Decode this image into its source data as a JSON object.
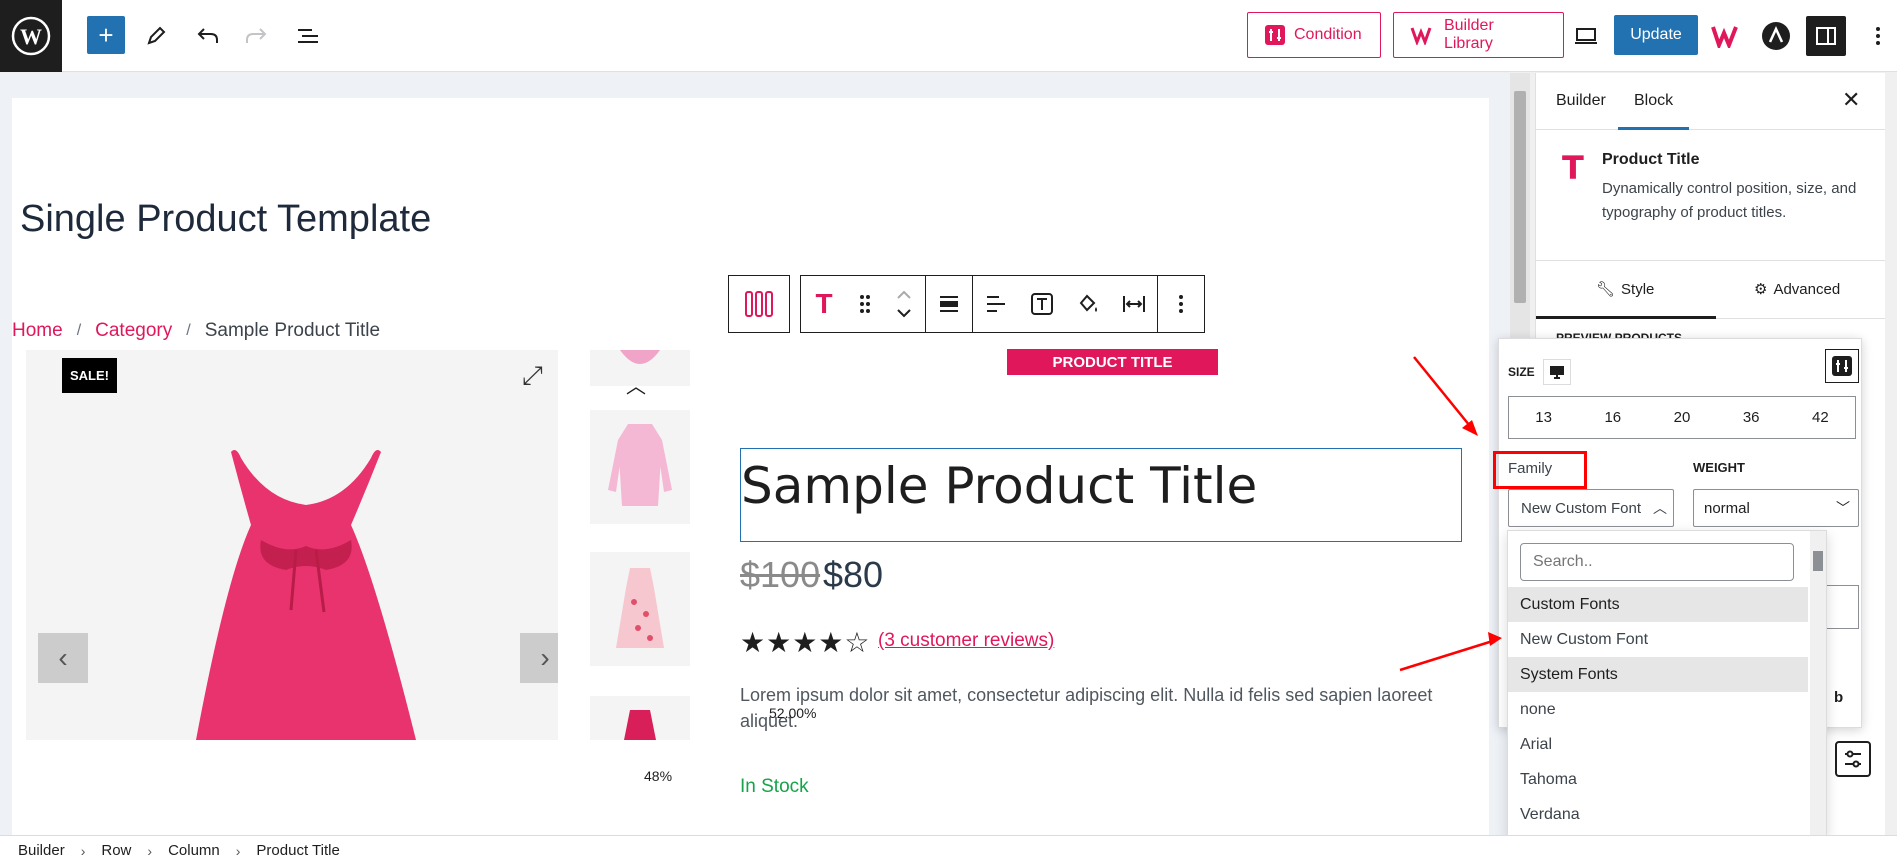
{
  "topbar": {
    "condition_label": "Condition",
    "library_label": "Builder Library",
    "update_label": "Update"
  },
  "page": {
    "title": "Single Product Template",
    "breadcrumb": [
      "Home",
      "Category",
      "Sample Product Title"
    ],
    "sale_badge": "SALE!",
    "product_title": "Sample Product Title",
    "block_label": "PRODUCT TITLE",
    "price_old": "$100",
    "price_new": "$80",
    "rating": 4,
    "stars": "★★★★☆",
    "reviews": "(3 customer reviews)",
    "description": "Lorem ipsum dolor sit amet, consectetur adipiscing elit. Nulla id felis sed sapien laoreet aliquet.",
    "desc_overlay_pct": "52.00%",
    "thumb_pct": "48%",
    "stock": "In Stock"
  },
  "panel": {
    "tabs": [
      "Builder",
      "Block"
    ],
    "active_tab": "Block",
    "block_name": "Product Title",
    "block_desc": "Dynamically control position, size, and typography of product titles.",
    "style_tab": "Style",
    "advanced_tab": "Advanced",
    "peek_text": "PREVIEW PRODUCTS",
    "behind_text": "b"
  },
  "typography": {
    "size_label": "SIZE",
    "sizes": [
      "13",
      "16",
      "20",
      "36",
      "42"
    ],
    "family_label": "Family",
    "family_value": "New Custom Font",
    "weight_label": "WEIGHT",
    "weight_value": "normal",
    "search_placeholder": "Search..",
    "options": [
      {
        "label": "Custom Fonts",
        "group": true
      },
      {
        "label": "New Custom Font",
        "group": false
      },
      {
        "label": "System Fonts",
        "group": true
      },
      {
        "label": "none",
        "group": false
      },
      {
        "label": "Arial",
        "group": false
      },
      {
        "label": "Tahoma",
        "group": false
      },
      {
        "label": "Verdana",
        "group": false
      }
    ]
  },
  "footer": {
    "crumbs": [
      "Builder",
      "Row",
      "Column",
      "Product Title"
    ]
  },
  "colors": {
    "accent": "#e0185b",
    "primary": "#2271b1",
    "annotation": "#ff0000",
    "stock": "#16a34a"
  }
}
